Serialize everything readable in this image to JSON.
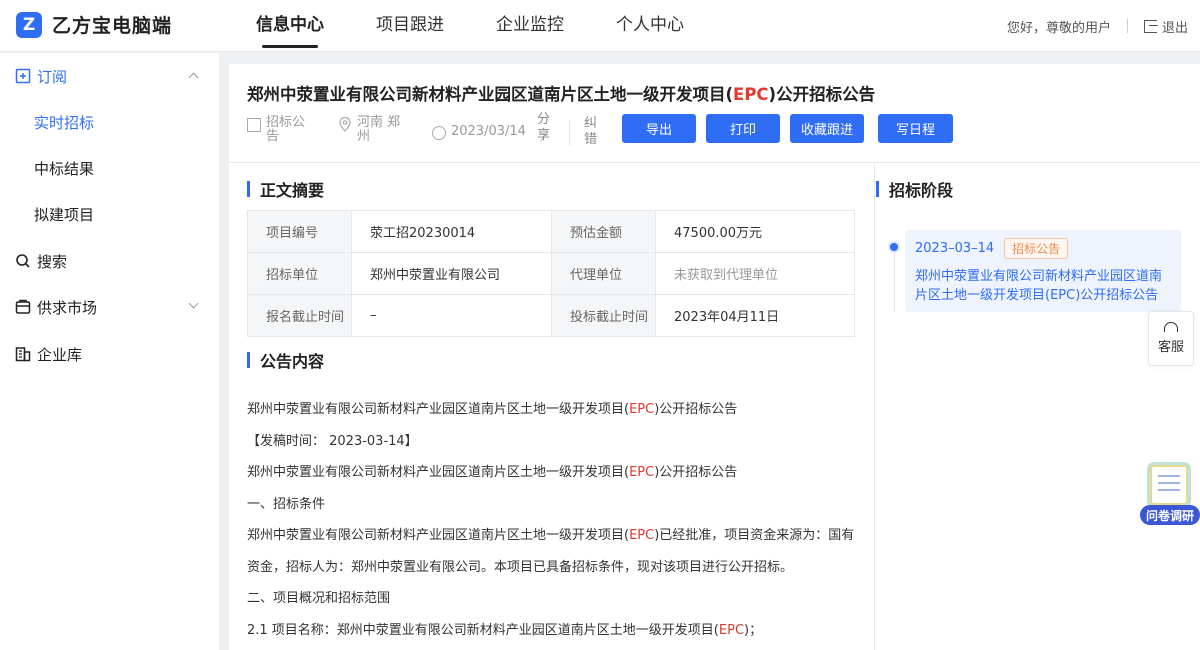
{
  "app": {
    "logo_mark": "Z",
    "title": "乙方宝电脑端"
  },
  "nav": {
    "items": [
      "信息中心",
      "项目跟进",
      "企业监控",
      "个人中心"
    ],
    "active": "信息中心"
  },
  "user": {
    "greeting": "您好，尊敬的用户",
    "logout": "退出"
  },
  "sidebar": {
    "subscribe": "订阅",
    "sub_items": [
      "实时招标",
      "中标结果",
      "拟建项目"
    ],
    "search": "搜索",
    "market": "供求市场",
    "company": "企业库"
  },
  "notice": {
    "title_part1": "郑州中荥置业有限公司新材料产业园区道南片区土地一级开发项目(",
    "title_epc": "EPC",
    "title_part2": ")公开招标公告",
    "type_l1": "招标公",
    "type_l2": "告",
    "region_l1": "河南 郑",
    "region_l2": "州",
    "date": "2023/03/14",
    "share_l1": "分",
    "share_l2": "享",
    "correct_l1": "纠",
    "correct_l2": "错"
  },
  "buttons": {
    "export": "导出",
    "print": "打印",
    "collect": "收藏跟进",
    "schedule": "写日程"
  },
  "summary": {
    "title": "正文摘要",
    "rows": [
      {
        "k1": "项目编号",
        "v1": "荥工招20230014",
        "k2": "预估金额",
        "v2": "47500.00万元"
      },
      {
        "k1": "招标单位",
        "v1": "郑州中荥置业有限公司",
        "k2": "代理单位",
        "v2": "未获取到代理单位"
      },
      {
        "k1": "报名截止时间",
        "v1": "–",
        "k2": "投标截止时间",
        "v2": "2023年04月11日"
      }
    ]
  },
  "content": {
    "title": "公告内容",
    "l1a": "郑州中荥置业有限公司新材料产业园区道南片区土地一级开发项目(",
    "l1b": "EPC",
    "l1c": ")公开招标公告",
    "l2": "【发稿时间： 2023-03-14】",
    "l3a": "郑州中荥置业有限公司新材料产业园区道南片区土地一级开发项目(",
    "l3b": "EPC",
    "l3c": ")公开招标公告",
    "l4": "一、招标条件",
    "l5a": "郑州中荥置业有限公司新材料产业园区道南片区土地一级开发项目(",
    "l5b": "EPC",
    "l5c": ")已经批准，项目资金来源为：国有",
    "l6": "资金，招标人为：郑州中荥置业有限公司。本项目已具备招标条件，现对该项目进行公开招标。",
    "l7": "二、项目概况和招标范围",
    "l8a": "2.1 项目名称：郑州中荥置业有限公司新材料产业园区道南片区土地一级开发项目(",
    "l8b": "EPC",
    "l8c": ")；"
  },
  "stage": {
    "title": "招标阶段",
    "date": "2023–03–14",
    "tag": "招标公告",
    "text_l1": "郑州中荥置业有限公司新材料产业园区道南",
    "text_l2": "片区土地一级开发项目(EPC)公开招标公告"
  },
  "float": {
    "kefu": "客服",
    "survey": "问卷调研"
  },
  "colors": {
    "accent": "#2f6df4",
    "red": "#e23a2e",
    "tag_orange": "#ef8a4d"
  }
}
